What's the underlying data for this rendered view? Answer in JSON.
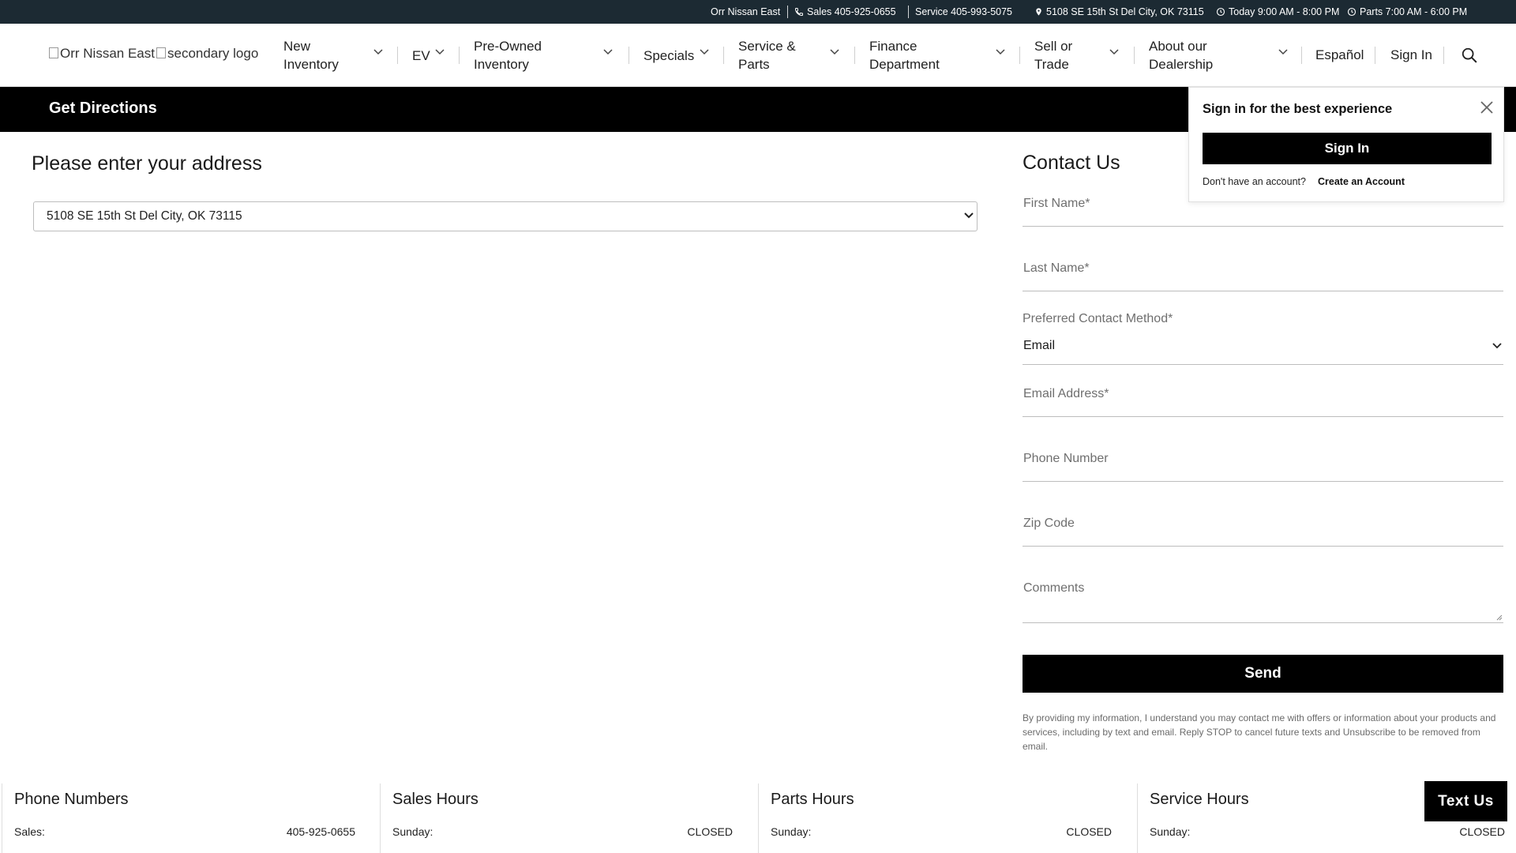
{
  "topbar": {
    "dealer": "Orr Nissan East",
    "sales": "Sales 405-925-0655",
    "service": "Service 405-993-5075",
    "address": "5108 SE 15th St Del City, OK 73115",
    "today_hours": "Today 9:00 AM - 8:00 PM",
    "parts_hours": "Parts 7:00 AM - 6:00 PM"
  },
  "header": {
    "logo_alt": "Orr Nissan East",
    "secondary_logo_alt": "secondary logo",
    "nav": [
      {
        "line1": "New",
        "line2": "Inventory"
      },
      {
        "line1": "EV",
        "line2": ""
      },
      {
        "line1": "Pre-Owned",
        "line2": "Inventory"
      },
      {
        "line1": "Specials",
        "line2": ""
      },
      {
        "line1": "Service &",
        "line2": "Parts"
      },
      {
        "line1": "Finance",
        "line2": "Department"
      },
      {
        "line1": "Sell or",
        "line2": "Trade"
      },
      {
        "line1": "About our",
        "line2": "Dealership"
      }
    ],
    "espanol": "Español",
    "sign_in": "Sign In"
  },
  "band": {
    "title": "Get Directions"
  },
  "signin_popup": {
    "title": "Sign in for the best experience",
    "button": "Sign In",
    "note": "Don't have an account?",
    "link": "Create an Account"
  },
  "directions": {
    "heading": "Please enter your address",
    "selected_address": "5108 SE 15th St Del City, OK 73115"
  },
  "contact": {
    "title": "Contact Us",
    "first_name": "First Name*",
    "last_name": "Last Name*",
    "method_label": "Preferred Contact Method*",
    "method_value": "Email",
    "email": "Email Address*",
    "phone": "Phone Number",
    "zip": "Zip Code",
    "comments": "Comments",
    "send": "Send",
    "disclaimer": "By providing my information, I understand you may contact me with offers or information about your products and services, including by text and email. Reply STOP to cancel future texts and Unsubscribe to be removed from email."
  },
  "hours": [
    {
      "title": "Phone Numbers",
      "label": "Sales:",
      "value": "405-925-0655"
    },
    {
      "title": "Sales Hours",
      "label": "Sunday:",
      "value": "CLOSED"
    },
    {
      "title": "Parts Hours",
      "label": "Sunday:",
      "value": "CLOSED"
    },
    {
      "title": "Service Hours",
      "label": "Sunday:",
      "value": "CLOSED"
    }
  ],
  "text_us": "Text Us",
  "colors": {
    "topbar_bg": "#1c2a33",
    "band_bg": "#000000",
    "button_bg": "#000000"
  }
}
